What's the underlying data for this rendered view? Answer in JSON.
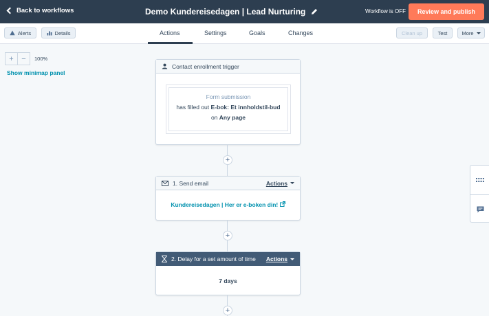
{
  "header": {
    "back_label": "Back to workflows",
    "title": "Demo Kundereisedagen | Lead Nurturing",
    "status": "Workflow is OFF",
    "publish_label": "Review and publish"
  },
  "toolbar": {
    "alerts_label": "Alerts",
    "details_label": "Details",
    "tabs": [
      "Actions",
      "Settings",
      "Goals",
      "Changes"
    ],
    "cleanup_label": "Clean up",
    "test_label": "Test",
    "more_label": "More"
  },
  "canvas": {
    "zoom_level": "100%",
    "minimap_label": "Show minimap panel"
  },
  "trigger": {
    "header": "Contact enrollment trigger",
    "type": "Form submission",
    "text_pre": "has filled out",
    "form_name": "E-bok: Et innholdstil-bud",
    "text_on": "on",
    "page": "Any page"
  },
  "step1": {
    "header": "1. Send email",
    "actions_label": "Actions",
    "email_name": "Kundereisedagen | Her er e-boken din!"
  },
  "step2": {
    "header": "2. Delay for a set amount of time",
    "actions_label": "Actions",
    "delay": "7 days"
  },
  "colors": {
    "header_bg": "#2d3e50",
    "accent": "#ff7a59",
    "link": "#0091ae"
  }
}
